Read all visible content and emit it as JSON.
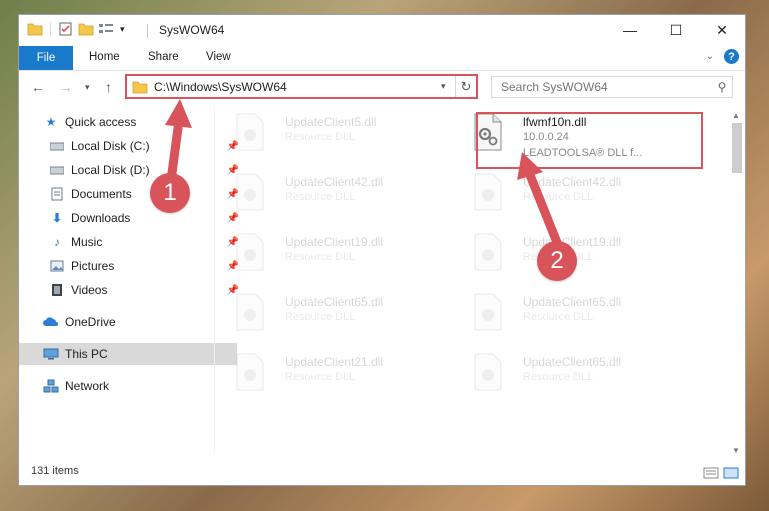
{
  "window": {
    "title": "SysWOW64",
    "controls": [
      "—",
      "☐",
      "✕"
    ]
  },
  "ribbon": {
    "file": "File",
    "tabs": [
      "Home",
      "Share",
      "View"
    ]
  },
  "address": {
    "path": "C:\\Windows\\SysWOW64",
    "search_placeholder": "Search SysWOW64"
  },
  "sidebar": {
    "items": [
      {
        "label": "Quick access",
        "icon": "star-icon"
      },
      {
        "label": "Local Disk (C:)",
        "icon": "drive-icon",
        "pinned": true
      },
      {
        "label": "Local Disk (D:)",
        "icon": "drive-icon",
        "pinned": true
      },
      {
        "label": "Documents",
        "icon": "documents-icon",
        "pinned": true
      },
      {
        "label": "Downloads",
        "icon": "download-icon",
        "pinned": true
      },
      {
        "label": "Music",
        "icon": "music-icon",
        "pinned": true
      },
      {
        "label": "Pictures",
        "icon": "pictures-icon",
        "pinned": true
      },
      {
        "label": "Videos",
        "icon": "videos-icon",
        "pinned": true
      },
      {
        "label": "OneDrive",
        "icon": "cloud-icon"
      },
      {
        "label": "This PC",
        "icon": "computer-icon",
        "selected": true
      },
      {
        "label": "Network",
        "icon": "network-icon"
      }
    ]
  },
  "files": {
    "highlighted": {
      "name": "lfwmf10n.dll",
      "version": "10.0.0.24",
      "desc": "LEADTOOLSA® DLL f..."
    },
    "faded": [
      {
        "name": "UpdateClient5.dll",
        "desc": "Resource DLL"
      },
      {
        "name": "UpdateClient42.dll",
        "desc": "Resource DLL"
      },
      {
        "name": "UpdateClient42.dll",
        "desc": "Resource DLL"
      },
      {
        "name": "UpdateClient19.dll",
        "desc": "Resource DLL"
      },
      {
        "name": "UpdateClient19.dll",
        "desc": "Resource DLL"
      },
      {
        "name": "UpdateClient65.dll",
        "desc": "Resource DLL"
      },
      {
        "name": "UpdateClient65.dll",
        "desc": "Resource DLL"
      },
      {
        "name": "UpdateClient21.dll",
        "desc": "Resource DLL"
      },
      {
        "name": "UpdateClient65.dll",
        "desc": "Resource DLL"
      }
    ]
  },
  "status": {
    "count": "131 items"
  },
  "markers": [
    "1",
    "2"
  ],
  "colors": {
    "accent": "#1979ca",
    "annotation": "#d9535a"
  }
}
